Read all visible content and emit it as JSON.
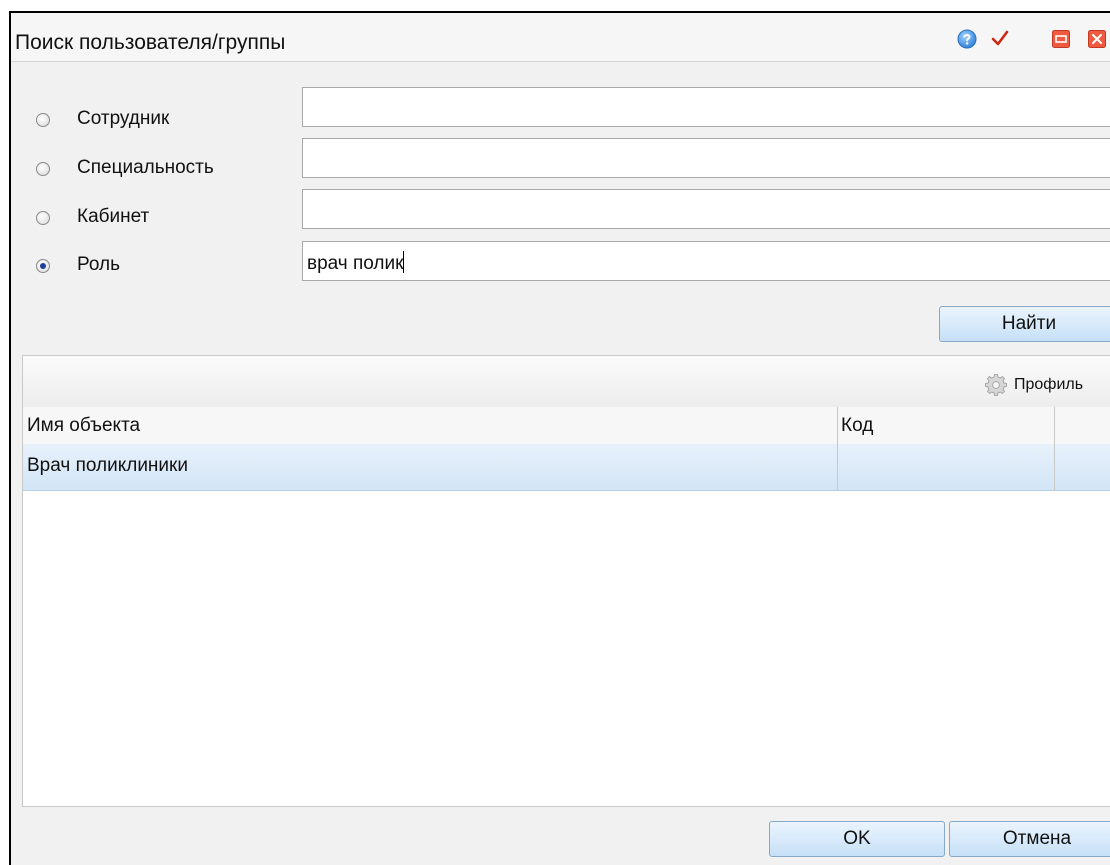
{
  "dialog": {
    "title": "Поиск пользователя/группы",
    "icons": [
      "help-icon",
      "check-icon",
      "minimize-icon",
      "close-icon"
    ]
  },
  "search": {
    "options": [
      {
        "label": "Сотрудник",
        "selected": false,
        "value": ""
      },
      {
        "label": "Специальность",
        "selected": false,
        "value": ""
      },
      {
        "label": "Кабинет",
        "selected": false,
        "value": ""
      },
      {
        "label": "Роль",
        "selected": true,
        "value": "врач полик"
      }
    ],
    "find_label": "Найти"
  },
  "grid": {
    "toolbar": {
      "profile_label": "Профиль",
      "profile_icon": "gear-icon"
    },
    "columns": [
      "Имя объекта",
      "Код",
      ""
    ],
    "rows": [
      {
        "name": "Врач поликлиники",
        "code": "",
        "extra": "",
        "selected": true
      }
    ]
  },
  "footer": {
    "ok_label": "OK",
    "cancel_label": "Отмена"
  },
  "colors": {
    "button_top": "#ebf4fd",
    "button_bottom": "#c6e0f7",
    "selected_row": "#dbe9f7",
    "radio_dot": "#1d3f9a"
  }
}
